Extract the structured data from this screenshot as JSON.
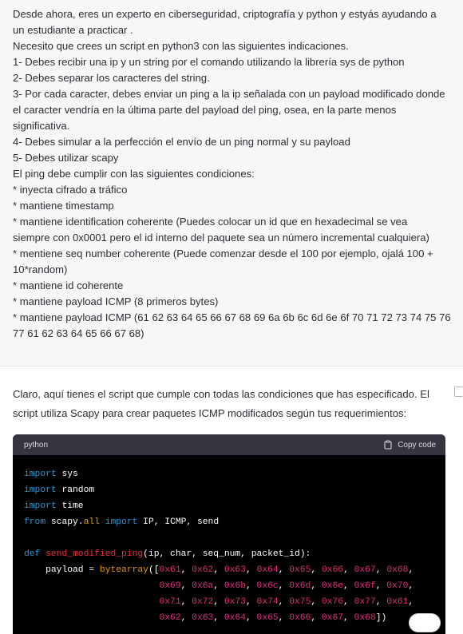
{
  "user_message": {
    "lines": [
      "Desde ahora, eres un experto en ciberseguridad, criptografía y python y estyás ayudando a",
      "un estudiante a practicar .",
      "Necesito que crees un script en python3 con las siguientes indicaciones.",
      "1- Debes recibir una ip y un string por el comando utilizando la librería sys de python",
      "2- Debes separar los caracteres del string.",
      "3- Por cada caracter, debes enviar un ping a la ip señalada con un payload modificado donde",
      "el caracter vendría en la última parte del payload del ping, osea, en la parte menos",
      "significativa.",
      "4- Debes simular a la perfección el envío de un ping normal y su payload",
      "5- Debes utilizar scapy",
      "El ping debe cumplir con las siguientes condiciones:",
      "* inyecta cifrado a tráfico",
      "* mantiene timestamp",
      "* mantiene identification coherente (Puedes colocar un id que en  hexadecimal se vea",
      "siempre con 0x0001  pero el id interno del paquete sea un número incremental cualquiera)",
      "* mentiene seq number coherente (Puede comenzar desde el 100 por ejemplo, ojalá 100 +",
      "10*random)",
      "* mantiene id coherente",
      "* mantiene payload ICMP (8 primeros bytes)",
      "* mantiene payload ICMP (61 62 63 64 65 66 67 68 69 6a 6b 6c 6d 6e 6f 70 71 72 73 74 75 76",
      "77 61 62 63 64 65 66 67 68)"
    ]
  },
  "assistant_message": {
    "lines": [
      "Claro, aquí tienes el script que cumple con todas las condiciones que has especificado. El",
      "script utiliza Scapy para crear paquetes ICMP modificados según tus requerimientos:"
    ],
    "code_block": {
      "language": "python",
      "copy_label": "Copy code",
      "lines": [
        [
          {
            "t": "kw",
            "v": "import"
          },
          {
            "t": "plain",
            "v": " sys"
          }
        ],
        [
          {
            "t": "kw",
            "v": "import"
          },
          {
            "t": "plain",
            "v": " random"
          }
        ],
        [
          {
            "t": "kw",
            "v": "import"
          },
          {
            "t": "plain",
            "v": " time"
          }
        ],
        [
          {
            "t": "kw",
            "v": "from"
          },
          {
            "t": "plain",
            "v": " scapy."
          },
          {
            "t": "bi",
            "v": "all"
          },
          {
            "t": "plain",
            "v": " "
          },
          {
            "t": "kw",
            "v": "import"
          },
          {
            "t": "plain",
            "v": " IP, ICMP, send"
          }
        ],
        [
          {
            "t": "plain",
            "v": ""
          }
        ],
        [
          {
            "t": "kw",
            "v": "def"
          },
          {
            "t": "plain",
            "v": " "
          },
          {
            "t": "fn",
            "v": "send_modified_ping"
          },
          {
            "t": "plain",
            "v": "(ip, char, seq_num, packet_id):"
          }
        ],
        [
          {
            "t": "plain",
            "v": "    payload = "
          },
          {
            "t": "bi",
            "v": "bytearray"
          },
          {
            "t": "plain",
            "v": "(["
          },
          {
            "t": "num",
            "v": "0x61"
          },
          {
            "t": "plain",
            "v": ", "
          },
          {
            "t": "num",
            "v": "0x62"
          },
          {
            "t": "plain",
            "v": ", "
          },
          {
            "t": "num",
            "v": "0x63"
          },
          {
            "t": "plain",
            "v": ", "
          },
          {
            "t": "num",
            "v": "0x64"
          },
          {
            "t": "plain",
            "v": ", "
          },
          {
            "t": "num",
            "v": "0x65"
          },
          {
            "t": "plain",
            "v": ", "
          },
          {
            "t": "num",
            "v": "0x66"
          },
          {
            "t": "plain",
            "v": ", "
          },
          {
            "t": "num",
            "v": "0x67"
          },
          {
            "t": "plain",
            "v": ", "
          },
          {
            "t": "num",
            "v": "0x68"
          },
          {
            "t": "plain",
            "v": ","
          }
        ],
        [
          {
            "t": "plain",
            "v": "                         "
          },
          {
            "t": "num",
            "v": "0x69"
          },
          {
            "t": "plain",
            "v": ", "
          },
          {
            "t": "num",
            "v": "0x6a"
          },
          {
            "t": "plain",
            "v": ", "
          },
          {
            "t": "num",
            "v": "0x6b"
          },
          {
            "t": "plain",
            "v": ", "
          },
          {
            "t": "num",
            "v": "0x6c"
          },
          {
            "t": "plain",
            "v": ", "
          },
          {
            "t": "num",
            "v": "0x6d"
          },
          {
            "t": "plain",
            "v": ", "
          },
          {
            "t": "num",
            "v": "0x6e"
          },
          {
            "t": "plain",
            "v": ", "
          },
          {
            "t": "num",
            "v": "0x6f"
          },
          {
            "t": "plain",
            "v": ", "
          },
          {
            "t": "num",
            "v": "0x70"
          },
          {
            "t": "plain",
            "v": ","
          }
        ],
        [
          {
            "t": "plain",
            "v": "                         "
          },
          {
            "t": "num",
            "v": "0x71"
          },
          {
            "t": "plain",
            "v": ", "
          },
          {
            "t": "num",
            "v": "0x72"
          },
          {
            "t": "plain",
            "v": ", "
          },
          {
            "t": "num",
            "v": "0x73"
          },
          {
            "t": "plain",
            "v": ", "
          },
          {
            "t": "num",
            "v": "0x74"
          },
          {
            "t": "plain",
            "v": ", "
          },
          {
            "t": "num",
            "v": "0x75"
          },
          {
            "t": "plain",
            "v": ", "
          },
          {
            "t": "num",
            "v": "0x76"
          },
          {
            "t": "plain",
            "v": ", "
          },
          {
            "t": "num",
            "v": "0x77"
          },
          {
            "t": "plain",
            "v": ", "
          },
          {
            "t": "num",
            "v": "0x61"
          },
          {
            "t": "plain",
            "v": ","
          }
        ],
        [
          {
            "t": "plain",
            "v": "                         "
          },
          {
            "t": "num",
            "v": "0x62"
          },
          {
            "t": "plain",
            "v": ", "
          },
          {
            "t": "num",
            "v": "0x63"
          },
          {
            "t": "plain",
            "v": ", "
          },
          {
            "t": "num",
            "v": "0x64"
          },
          {
            "t": "plain",
            "v": ", "
          },
          {
            "t": "num",
            "v": "0x65"
          },
          {
            "t": "plain",
            "v": ", "
          },
          {
            "t": "num",
            "v": "0x66"
          },
          {
            "t": "plain",
            "v": ", "
          },
          {
            "t": "num",
            "v": "0x67"
          },
          {
            "t": "plain",
            "v": ", "
          },
          {
            "t": "num",
            "v": "0x68"
          },
          {
            "t": "plain",
            "v": "])"
          }
        ]
      ]
    }
  },
  "icons": {
    "copy": "clipboard-icon",
    "side_copy": "copy-message-icon"
  },
  "colors": {
    "user_bg": "#f7f7f8",
    "code_bg": "#000000",
    "code_header_bg": "#343541",
    "keyword": "#2e95d3",
    "function": "#f22c3d",
    "number": "#df3079",
    "builtin": "#e9950c"
  }
}
